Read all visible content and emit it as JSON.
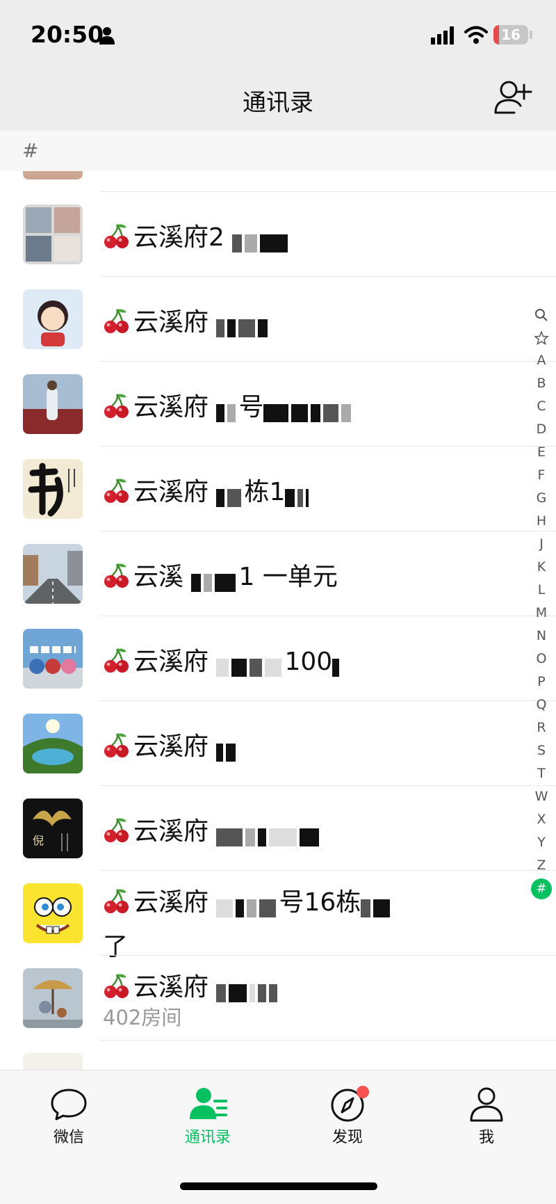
{
  "status_bar": {
    "time": "20:50",
    "battery_level": "16",
    "battery_fraction": 0.16,
    "colors": {
      "battery_low": "#e54b4b"
    }
  },
  "navbar": {
    "title": "通讯录",
    "add_friend_icon": "add-contact-icon"
  },
  "section": {
    "header": "#"
  },
  "contacts": [
    {
      "name_visible": "云溪府",
      "name_suffix": "2",
      "subtitle": ""
    },
    {
      "name_visible": "云溪府",
      "name_suffix": "",
      "subtitle": ""
    },
    {
      "name_visible": "云溪府",
      "name_suffix": "号",
      "subtitle": ""
    },
    {
      "name_visible": "云溪府",
      "name_suffix": "栋1",
      "subtitle": ""
    },
    {
      "name_visible": "云溪",
      "name_suffix": "1 一单元",
      "subtitle": ""
    },
    {
      "name_visible": "云溪府",
      "name_suffix": "100",
      "subtitle": ""
    },
    {
      "name_visible": "云溪府",
      "name_suffix": "",
      "subtitle": ""
    },
    {
      "name_visible": "云溪府",
      "name_suffix": "",
      "subtitle": ""
    },
    {
      "name_visible": "云溪府",
      "name_suffix": "号16栋",
      "subtitle": "了"
    },
    {
      "name_visible": "云溪府",
      "name_suffix": "",
      "subtitle": "402房间"
    }
  ],
  "index_bar": {
    "items": [
      "A",
      "B",
      "C",
      "D",
      "E",
      "F",
      "G",
      "H",
      "J",
      "K",
      "L",
      "M",
      "N",
      "O",
      "P",
      "Q",
      "R",
      "S",
      "T",
      "W",
      "X",
      "Y",
      "Z"
    ],
    "active": "#"
  },
  "tabbar": {
    "tabs": [
      {
        "label": "微信",
        "icon": "chat-bubble-icon"
      },
      {
        "label": "通讯录",
        "icon": "contacts-icon",
        "active": true
      },
      {
        "label": "发现",
        "icon": "compass-icon",
        "badge": true
      },
      {
        "label": "我",
        "icon": "person-icon"
      }
    ],
    "colors": {
      "active": "#07c160",
      "badge": "#fa5151"
    }
  }
}
